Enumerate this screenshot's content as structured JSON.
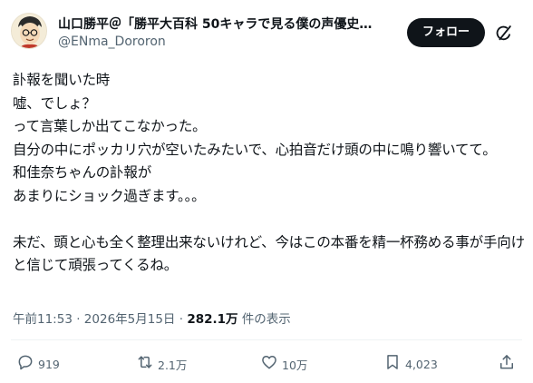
{
  "author": {
    "display_name": "山口勝平＠「勝平大百科 50キャラで見る僕の声優史…",
    "handle": "@ENma_Dororon"
  },
  "follow_label": "フォロー",
  "post_text": "訃報を聞いた時\n嘘、でしょ？\nって言葉しか出てこなかった。\n自分の中にポッカリ穴が空いたみたいで、心拍音だけ頭の中に鳴り響いてて。\n和佳奈ちゃんの訃報が\nあまりにショック過ぎます。。。\n\n未だ、頭と心も全く整理出来ないけれど、今はこの本番を精一杯務める事が手向けと信じて頑張ってくるね。",
  "meta": {
    "time": "午前11:53",
    "separator": "·",
    "date": "2026年5月15日",
    "views_count": "282.1万",
    "views_label": "件の表示"
  },
  "actions": {
    "replies": "919",
    "reposts": "2.1万",
    "likes": "10万",
    "bookmarks": "4,023"
  },
  "icons": {
    "reply": "reply-icon",
    "repost": "repost-icon",
    "like": "heart-icon",
    "bookmark": "bookmark-icon",
    "share": "share-icon",
    "grok": "grok-icon"
  },
  "colors": {
    "text": "#0f1419",
    "secondary": "#536471",
    "follow_button_bg": "#0f1419"
  }
}
